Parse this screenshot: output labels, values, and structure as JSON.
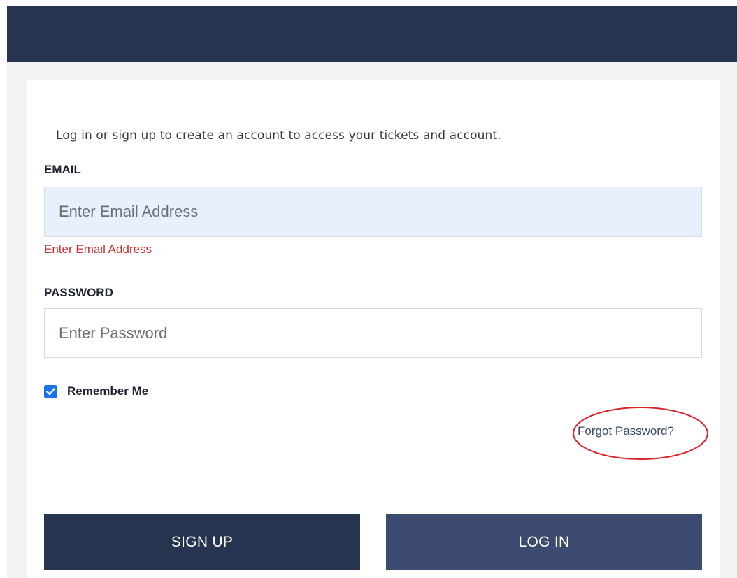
{
  "intro": {
    "text": "Log in or sign up to create an account to access your tickets and account."
  },
  "email": {
    "label": "EMAIL",
    "placeholder": "Enter Email Address",
    "value": "",
    "error": "Enter Email Address"
  },
  "password": {
    "label": "PASSWORD",
    "placeholder": "Enter Password",
    "value": ""
  },
  "remember": {
    "label": "Remember Me",
    "checked": true
  },
  "forgot": {
    "label": "Forgot Password?"
  },
  "buttons": {
    "signup": "SIGN UP",
    "login": "LOG IN"
  },
  "colors": {
    "header": "#27344f",
    "signup_button": "#27344f",
    "login_button": "#3e4b70",
    "email_autofill_bg": "#e8f0fe",
    "error": "#cc2e2e",
    "checkbox": "#1a73e8",
    "annotation_circle": "#d9232d"
  },
  "icons": {
    "checkbox": "checkmark-icon"
  }
}
